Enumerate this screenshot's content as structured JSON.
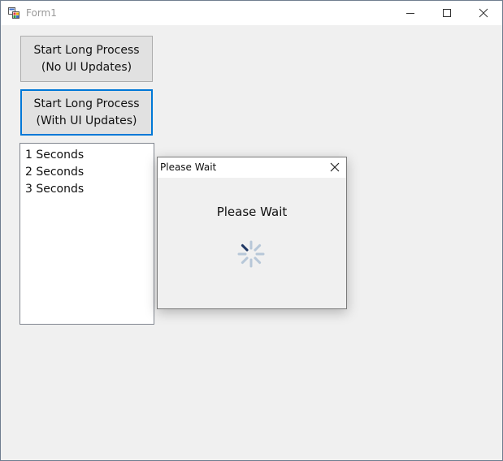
{
  "window": {
    "title": "Form1"
  },
  "buttons": {
    "no_updates": {
      "line1": "Start Long Process",
      "line2": "(No UI Updates)"
    },
    "with_updates": {
      "line1": "Start Long Process",
      "line2": "(With UI Updates)"
    }
  },
  "listbox": {
    "items": [
      "1 Seconds",
      "2 Seconds",
      "3 Seconds"
    ]
  },
  "dialog": {
    "title": "Please Wait",
    "message": "Please Wait"
  },
  "colors": {
    "focus_border": "#0078d7",
    "spinner_active": "#1f3864",
    "spinner_faded": "#b7c7d8"
  },
  "icons": [
    "app-icon",
    "minimize-icon",
    "maximize-icon",
    "close-icon",
    "spinner-icon"
  ]
}
